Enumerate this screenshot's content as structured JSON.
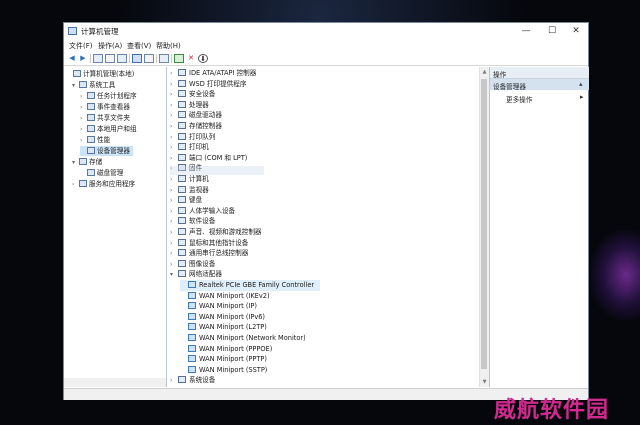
{
  "window": {
    "title": "计算机管理",
    "controls": {
      "minimize": "—",
      "maximize": "☐",
      "close": "✕"
    }
  },
  "menu": [
    "文件(F)",
    "操作(A)",
    "查看(V)",
    "帮助(H)"
  ],
  "toolbar": {
    "back": "◀",
    "forward": "▶",
    "delete": "✕",
    "update": "⬇"
  },
  "left_tree": [
    {
      "label": "计算机管理(本地)",
      "arrow": "",
      "level": 0
    },
    {
      "label": "系统工具",
      "arrow": "▾",
      "level": 1
    },
    {
      "label": "任务计划程序",
      "arrow": "›",
      "level": 2
    },
    {
      "label": "事件查看器",
      "arrow": "›",
      "level": 2
    },
    {
      "label": "共享文件夹",
      "arrow": "›",
      "level": 2
    },
    {
      "label": "本地用户和组",
      "arrow": "›",
      "level": 2
    },
    {
      "label": "性能",
      "arrow": "›",
      "level": 2
    },
    {
      "label": "设备管理器",
      "arrow": "",
      "level": 2,
      "selected": true
    },
    {
      "label": "存储",
      "arrow": "▾",
      "level": 1
    },
    {
      "label": "磁盘管理",
      "arrow": "",
      "level": 2
    },
    {
      "label": "服务和应用程序",
      "arrow": "›",
      "level": 1
    }
  ],
  "device_tree": [
    {
      "label": "IDE ATA/ATAPI 控制器",
      "arrow": "›"
    },
    {
      "label": "WSD 打印提供程序",
      "arrow": "›"
    },
    {
      "label": "安全设备",
      "arrow": "›"
    },
    {
      "label": "处理器",
      "arrow": "›"
    },
    {
      "label": "磁盘驱动器",
      "arrow": "›"
    },
    {
      "label": "存储控制器",
      "arrow": "›"
    },
    {
      "label": "打印队列",
      "arrow": "›"
    },
    {
      "label": "打印机",
      "arrow": "›"
    },
    {
      "label": "端口 (COM 和 LPT)",
      "arrow": "›"
    },
    {
      "label": "固件",
      "arrow": "›"
    },
    {
      "label": "计算机",
      "arrow": "›"
    },
    {
      "label": "监视器",
      "arrow": "›"
    },
    {
      "label": "键盘",
      "arrow": "›"
    },
    {
      "label": "人体学输入设备",
      "arrow": "›"
    },
    {
      "label": "软件设备",
      "arrow": "›"
    },
    {
      "label": "声音、视频和游戏控制器",
      "arrow": "›"
    },
    {
      "label": "鼠标和其他指针设备",
      "arrow": "›"
    },
    {
      "label": "通用串行总线控制器",
      "arrow": "›"
    },
    {
      "label": "图像设备",
      "arrow": "›"
    },
    {
      "label": "网络适配器",
      "arrow": "▾"
    },
    {
      "label": "Realtek PCIe GBE Family Controller",
      "arrow": "",
      "child": true,
      "highlight": true
    },
    {
      "label": "WAN Miniport (IKEv2)",
      "arrow": "",
      "child": true
    },
    {
      "label": "WAN Miniport (IP)",
      "arrow": "",
      "child": true
    },
    {
      "label": "WAN Miniport (IPv6)",
      "arrow": "",
      "child": true
    },
    {
      "label": "WAN Miniport (L2TP)",
      "arrow": "",
      "child": true
    },
    {
      "label": "WAN Miniport (Network Monitor)",
      "arrow": "",
      "child": true
    },
    {
      "label": "WAN Miniport (PPPOE)",
      "arrow": "",
      "child": true
    },
    {
      "label": "WAN Miniport (PPTP)",
      "arrow": "",
      "child": true
    },
    {
      "label": "WAN Miniport (SSTP)",
      "arrow": "",
      "child": true
    },
    {
      "label": "系统设备",
      "arrow": "›"
    }
  ],
  "actions": {
    "header": "操作",
    "section": "设备管理器",
    "section_arrow": "▴",
    "more": "更多操作",
    "more_arrow": "▸"
  },
  "watermark": "威航软件园"
}
